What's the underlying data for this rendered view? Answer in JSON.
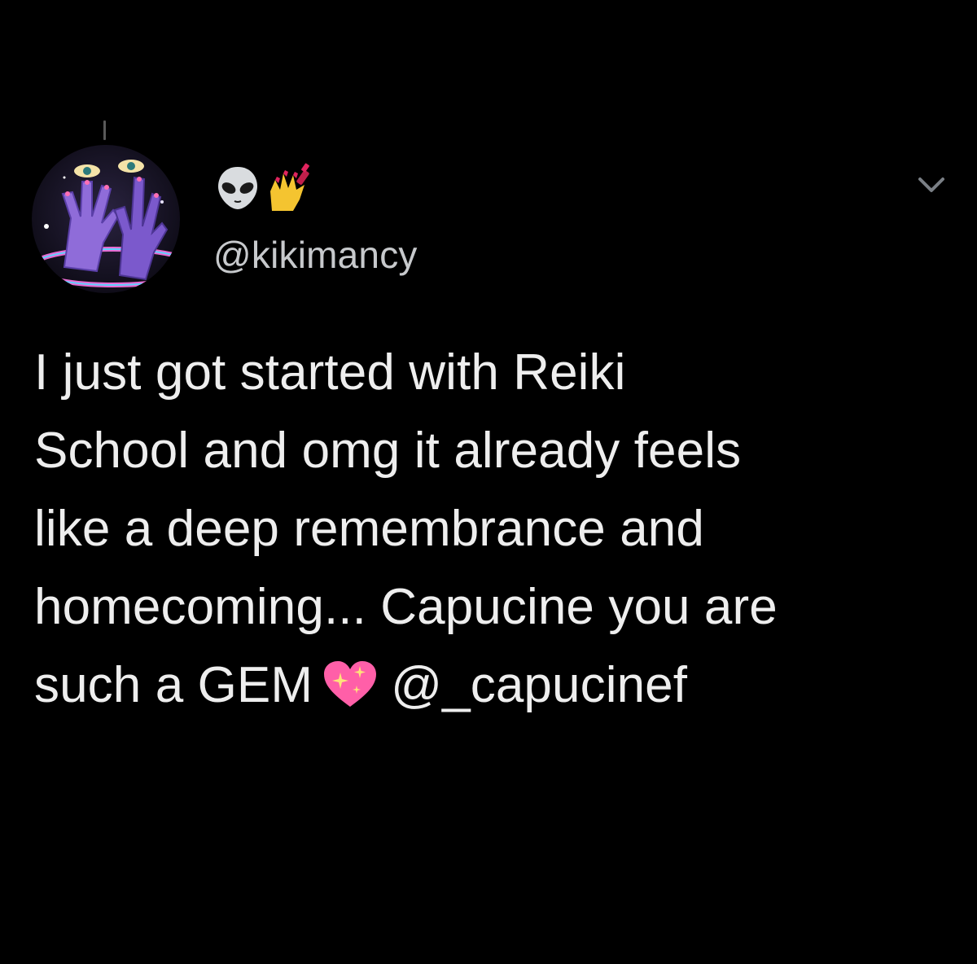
{
  "header": {
    "display_name_icons": [
      "alien-icon",
      "nail-polish-icon"
    ],
    "handle": "@kikimancy",
    "menu_icon": "chevron-down-icon"
  },
  "tweet": {
    "lines": [
      "I just got started with Reiki",
      "School and omg it already feels",
      "like a deep remembrance and",
      "homecoming... Capucine you are"
    ],
    "last_line_prefix": "such a GEM",
    "last_line_emoji": "sparkling-heart-icon",
    "mention": "@_capucinef"
  },
  "colors": {
    "background": "#000000",
    "text": "#eeeeee",
    "handle": "#c7c9cc",
    "heart": "#ff5fa8"
  }
}
